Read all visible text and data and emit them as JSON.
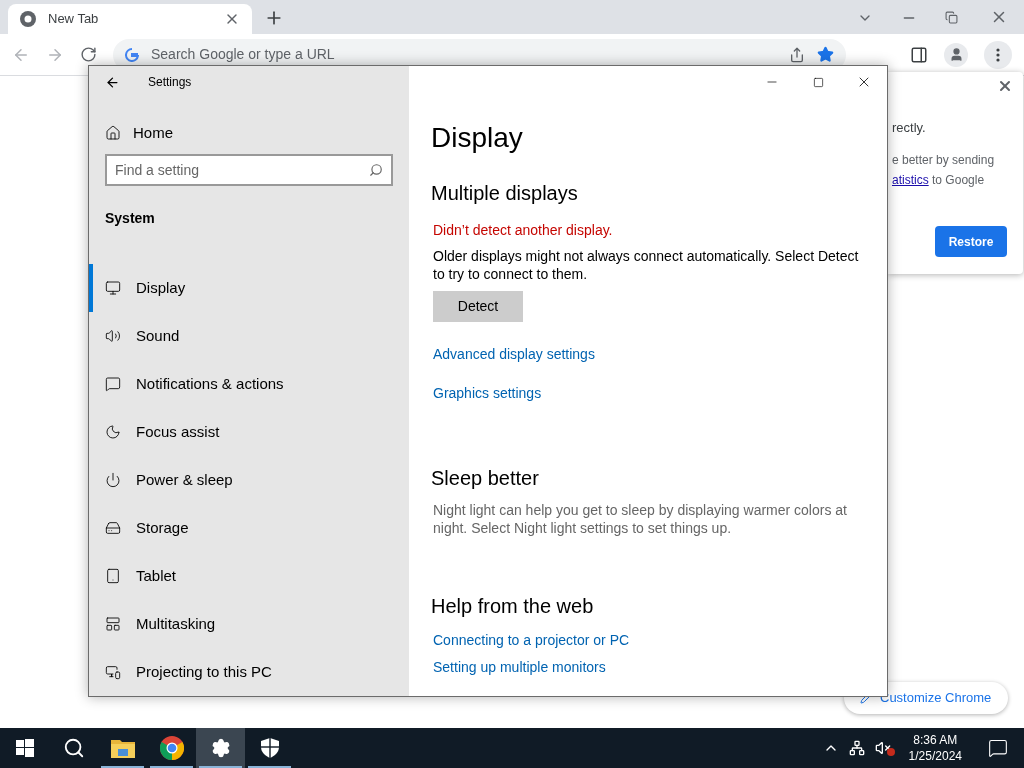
{
  "browser": {
    "tab": {
      "title": "New Tab"
    },
    "address_bar": {
      "placeholder": "Search Google or type a URL"
    },
    "bookmarked": true,
    "popup": {
      "line_1": "rectly.",
      "line_2": "e better by sending",
      "link": "atistics",
      "line_3": "to Google",
      "button": "Restore"
    },
    "customize_button": "Customize Chrome"
  },
  "settings": {
    "title": "Settings",
    "home": "Home",
    "search": {
      "placeholder": "Find a setting"
    },
    "section": "System",
    "items": [
      {
        "label": "Display",
        "kind": "display",
        "selected": true
      },
      {
        "label": "Sound",
        "kind": "sound",
        "selected": false
      },
      {
        "label": "Notifications & actions",
        "kind": "notifications",
        "selected": false
      },
      {
        "label": "Focus assist",
        "kind": "focus",
        "selected": false
      },
      {
        "label": "Power & sleep",
        "kind": "power",
        "selected": false
      },
      {
        "label": "Storage",
        "kind": "storage",
        "selected": false
      },
      {
        "label": "Tablet",
        "kind": "tablet",
        "selected": false
      },
      {
        "label": "Multitasking",
        "kind": "multitasking",
        "selected": false
      },
      {
        "label": "Projecting to this PC",
        "kind": "projecting",
        "selected": false
      }
    ],
    "page": {
      "title": "Display",
      "multiple_displays": {
        "heading": "Multiple displays",
        "error": "Didn’t detect another display.",
        "text": "Older displays might not always connect automatically. Select Detect to try to connect to them.",
        "button": "Detect",
        "links": [
          "Advanced display settings",
          "Graphics settings"
        ]
      },
      "sleep_better": {
        "heading": "Sleep better",
        "text": "Night light can help you get to sleep by displaying warmer colors at night. Select Night light settings to set things up."
      },
      "help": {
        "heading": "Help from the web",
        "links": [
          "Connecting to a projector or PC",
          "Setting up multiple monitors"
        ]
      }
    }
  },
  "taskbar": {
    "apps": [
      {
        "kind": "start",
        "running": false,
        "selected": false
      },
      {
        "kind": "search",
        "running": false,
        "selected": false
      },
      {
        "kind": "files",
        "running": true,
        "selected": false
      },
      {
        "kind": "chrome",
        "running": true,
        "selected": false
      },
      {
        "kind": "settings",
        "running": true,
        "selected": true
      },
      {
        "kind": "security",
        "running": true,
        "selected": false
      }
    ],
    "volume_muted": true,
    "time": "8:36 AM",
    "date": "1/25/2024"
  }
}
